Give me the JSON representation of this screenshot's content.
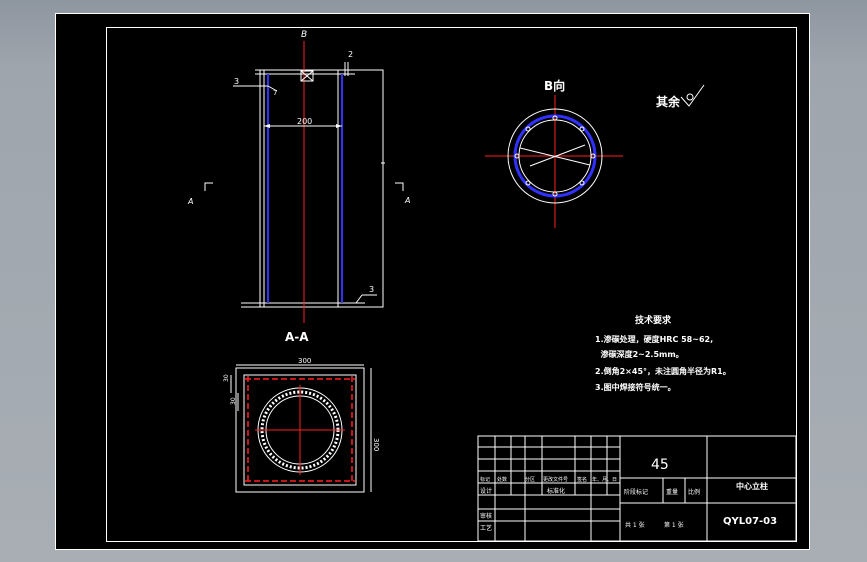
{
  "colors": {
    "background": "#000000",
    "line": "#ffffff",
    "centerline": "#ff2020",
    "hidden": "#3030ff",
    "viewport": "#a6acb2"
  },
  "elevation": {
    "section_label": "B",
    "cut_label_left": "A",
    "cut_label_right": "A",
    "dim_top_right": "2",
    "dim_top_left": "3",
    "dim_small": "7",
    "dim_width": "200",
    "dim_bottom_right": "3"
  },
  "view_b": {
    "title": "B向",
    "roughness_text": "其余"
  },
  "section_aa": {
    "title": "A-A",
    "dim_top": "300",
    "dim_right": "300",
    "dim_left_top": "30",
    "dim_left_mid": "30"
  },
  "tech_requirements": {
    "title": "技术要求",
    "lines": [
      "1.渗碳处理，硬度HRC 58~62,",
      "  渗碳深度2~2.5mm。",
      "2.倒角2×45°，未注圆角半径为R1。",
      "3.图中焊接符号统一。"
    ]
  },
  "title_block": {
    "material": "45",
    "part_name": "中心立柱",
    "drawing_no": "QYL07-03",
    "col_headers": [
      "标记",
      "处数",
      "分区",
      "更改文件号",
      "签名",
      "年、月、日"
    ],
    "row_design": "设计",
    "row_standardize": "标准化",
    "row_check": "审核",
    "row_process": "工艺",
    "stage_mark": "阶段标记",
    "weight": "重量",
    "scale": "比例",
    "sheets_total": "共 1 张",
    "sheet_no": "第 1 张"
  }
}
